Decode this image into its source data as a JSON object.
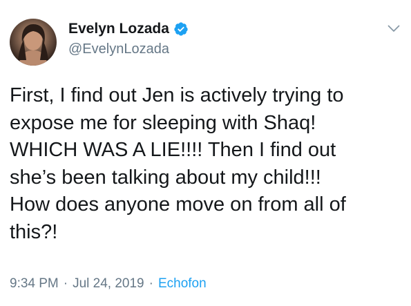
{
  "tweet": {
    "author": {
      "display_name": "Evelyn Lozada",
      "handle": "@EvelynLozada",
      "verified": true
    },
    "text": "First, I find out Jen is actively trying to\nexpose me for sleeping with Shaq!\nWHICH WAS A LIE!!!! Then I find out\nshe’s been talking about my child!!!\nHow does anyone move on from all of\nthis?!",
    "time": "9:34 PM",
    "date": "Jul 24, 2019",
    "source": "Echofon",
    "separator": "·"
  },
  "icons": {
    "verified": "verified-badge-icon",
    "more": "chevron-down-icon"
  },
  "colors": {
    "text": "#14171a",
    "secondary": "#657786",
    "accent": "#1da1f2",
    "background": "#ffffff"
  }
}
